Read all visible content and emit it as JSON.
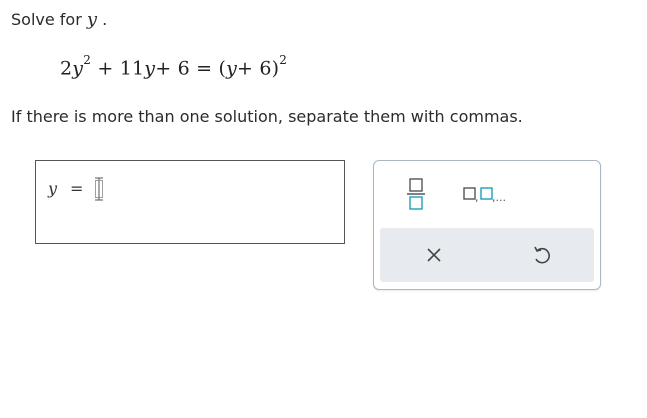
{
  "prompt": {
    "text": "Solve for",
    "variable": "y",
    "period": "."
  },
  "equation": {
    "lhs_coeff": "2",
    "lhs_var": "y",
    "lhs_exp": "2",
    "middle": "+ 11",
    "middle_var": "y",
    "plus_six": "+ 6 = (",
    "rhs_var": "y",
    "rhs_tail": "+ 6)",
    "rhs_exp": "2"
  },
  "instruction": "If there is more than one solution, separate them with commas.",
  "answer": {
    "variable": "y",
    "equals": "=",
    "value": ""
  },
  "palette": {
    "buttons": [
      "fraction",
      "list-with-commas",
      "clear",
      "undo"
    ],
    "list_suffix": ",..."
  },
  "colors": {
    "accent": "#1a9fbd",
    "palette_border": "#a9b8c4",
    "palette_footer": "#e7eaee",
    "icon_dark": "#333333"
  }
}
